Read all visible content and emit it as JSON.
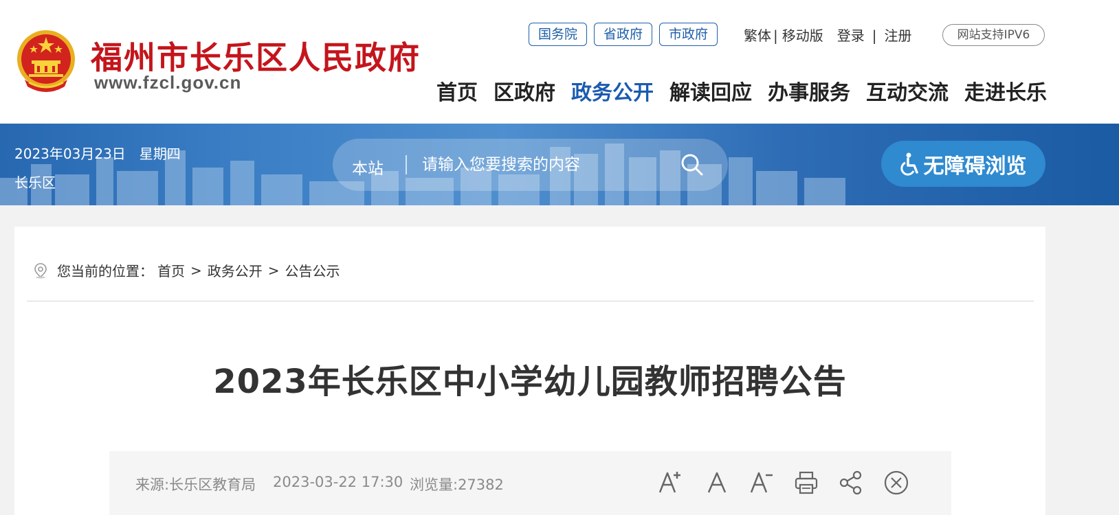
{
  "header": {
    "site_name": "福州市长乐区人民政府",
    "site_domain": "www.fzcl.gov.cn",
    "gov_links": [
      "国务院",
      "省政府",
      "市政府"
    ],
    "util_links": {
      "traditional": "繁体",
      "divider1": "|",
      "mobile": "移动版",
      "login": "登录",
      "divider2": "|",
      "register": "注册"
    },
    "ipv6_badge": "网站支持IPV6",
    "nav": [
      "首页",
      "区政府",
      "政务公开",
      "解读回应",
      "办事服务",
      "互动交流",
      "走进长乐"
    ],
    "active_nav": "政务公开"
  },
  "banner": {
    "date": "2023年03月23日　星期四",
    "region": "长乐区",
    "search_scope": "本站",
    "search_placeholder": "请输入您要搜索的内容",
    "accessibility_label": "无障碍浏览"
  },
  "content": {
    "breadcrumb": {
      "prefix": "您当前的位置：",
      "items": [
        "首页",
        "政务公开",
        "公告公示"
      ],
      "separator": ">"
    },
    "article_title": "2023年长乐区中小学幼儿园教师招聘公告",
    "meta": {
      "source": "来源:长乐区教育局",
      "datetime": "2023-03-22 17:30",
      "views": "浏览量:27382"
    },
    "tools": [
      "font-increase-icon",
      "font-normal-icon",
      "font-decrease-icon",
      "print-icon",
      "share-icon",
      "close-icon"
    ]
  },
  "colors": {
    "brand_red": "#c4151c",
    "nav_active": "#1a5bb0",
    "banner_blue": "#2768b1",
    "access_button": "#2f8ad0"
  }
}
